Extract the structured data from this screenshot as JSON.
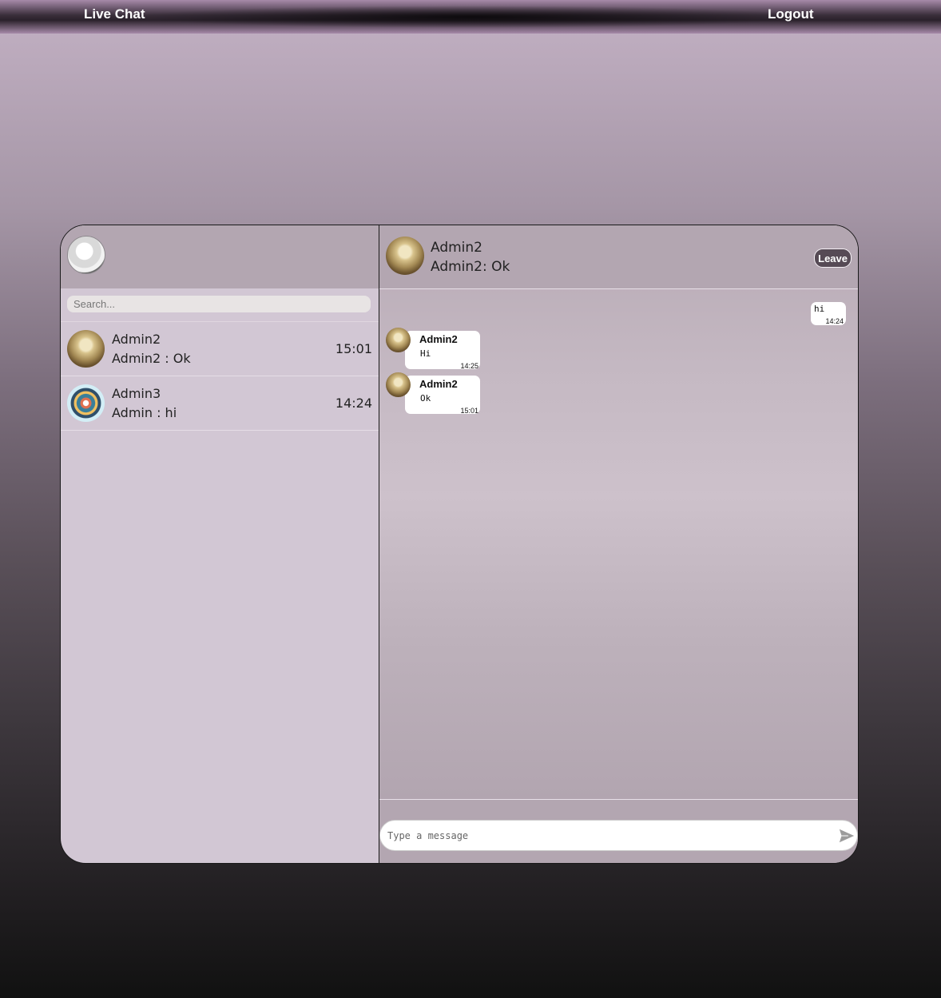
{
  "navbar": {
    "brand": "Live Chat",
    "logout": "Logout"
  },
  "sidebar": {
    "search_placeholder": "Search...",
    "conversations": [
      {
        "name": "Admin2",
        "preview": "Admin2 : Ok",
        "time": "15:01",
        "avatar": "book-avatar"
      },
      {
        "name": "Admin3",
        "preview": "Admin : hi",
        "time": "14:24",
        "avatar": "books-avatar"
      }
    ]
  },
  "chat": {
    "header": {
      "name": "Admin2",
      "status": "Admin2: Ok",
      "leave_label": "Leave"
    },
    "messages": [
      {
        "direction": "out",
        "text": "hi",
        "time": "14:24"
      },
      {
        "direction": "in",
        "sender": "Admin2",
        "text": "Hi",
        "time": "14:25"
      },
      {
        "direction": "in",
        "sender": "Admin2",
        "text": "Ok",
        "time": "15:01"
      }
    ],
    "compose_placeholder": "Type a message"
  },
  "colors": {
    "leave_button": "#564a55",
    "panel_header": "#b3a6b1",
    "sidebar_bg": "#d2c7d4"
  }
}
